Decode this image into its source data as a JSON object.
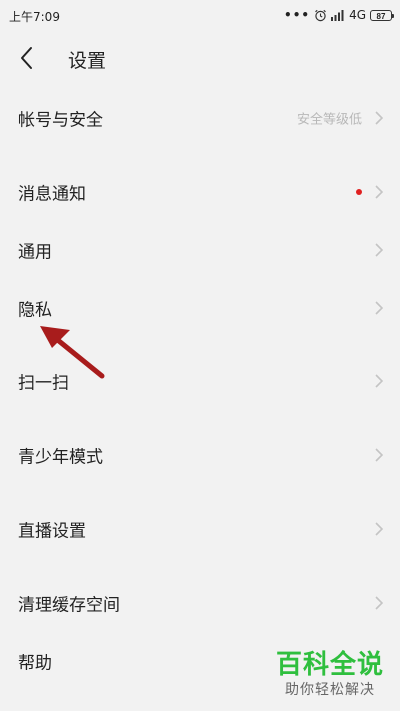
{
  "status_bar": {
    "time": "上午7:09",
    "network": "4G",
    "battery": "87",
    "icons": [
      "more-dots-icon",
      "alarm-icon",
      "signal-icon",
      "battery-icon"
    ]
  },
  "header": {
    "title": "设置",
    "back_icon": "back-chevron-icon"
  },
  "settings": {
    "items": [
      {
        "label": "帐号与安全",
        "value": "安全等级低"
      },
      {
        "label": "消息通知",
        "has_dot": true
      },
      {
        "label": "通用"
      },
      {
        "label": "隐私"
      },
      {
        "label": "扫一扫"
      },
      {
        "label": "青少年模式"
      },
      {
        "label": "直播设置"
      },
      {
        "label": "清理缓存空间"
      },
      {
        "label": "帮助"
      }
    ]
  },
  "watermark": {
    "title": "百科全说",
    "subtitle": "助你轻松解决"
  },
  "colors": {
    "background": "#f2f2f2",
    "text": "#222222",
    "secondary_text": "#b8b8b8",
    "chevron": "#c4c4c4",
    "red_dot": "#e02020",
    "annotation_arrow": "#a81c1c",
    "watermark_green": "#2fbf3e"
  }
}
